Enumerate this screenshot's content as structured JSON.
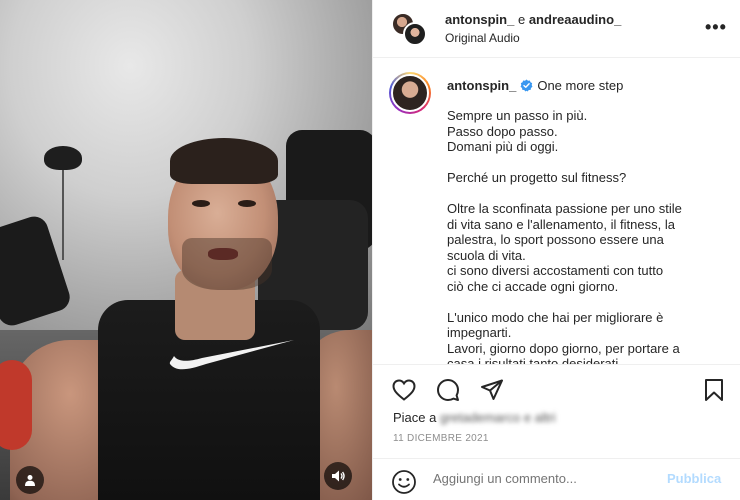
{
  "header": {
    "user1": "antonspin_",
    "joiner": "e",
    "user2": "andreaaudino_",
    "audio": "Original Audio",
    "more_label": "•••"
  },
  "caption": {
    "username": "antonspin_",
    "title": "One more step",
    "lines": [
      "Sempre un passo in più.",
      "Passo dopo passo.",
      "Domani più di oggi.",
      "",
      "Perché un progetto sul fitness?",
      "",
      "Oltre la sconfinata passione per uno stile",
      "di vita sano e l'allenamento, il fitness, la",
      "palestra, lo sport possono essere una",
      "scuola di vita.",
      "ci sono diversi accostamenti con tutto",
      "ciò che ci accade ogni giorno.",
      "",
      "L'unico modo che hai per migliorare è",
      "impegnarti.",
      "Lavori, giorno dopo giorno, per portare a",
      "casa i risultati tanto desiderati."
    ]
  },
  "likes": {
    "prefix": "Piace a",
    "name_blurred": "gretademarco e altri"
  },
  "date": "11 DICEMBRE 2021",
  "comment": {
    "placeholder": "Aggiungi un commento...",
    "publish_label": "Pubblica"
  },
  "colors": {
    "verified": "#3897f0",
    "publish_disabled": "#b3dbff",
    "muted": "#8e8e8e"
  },
  "icons": [
    "user-tag-icon",
    "audio-icon",
    "more-icon",
    "verified-icon",
    "heart-icon",
    "comment-icon",
    "share-icon",
    "bookmark-icon",
    "emoji-icon"
  ]
}
